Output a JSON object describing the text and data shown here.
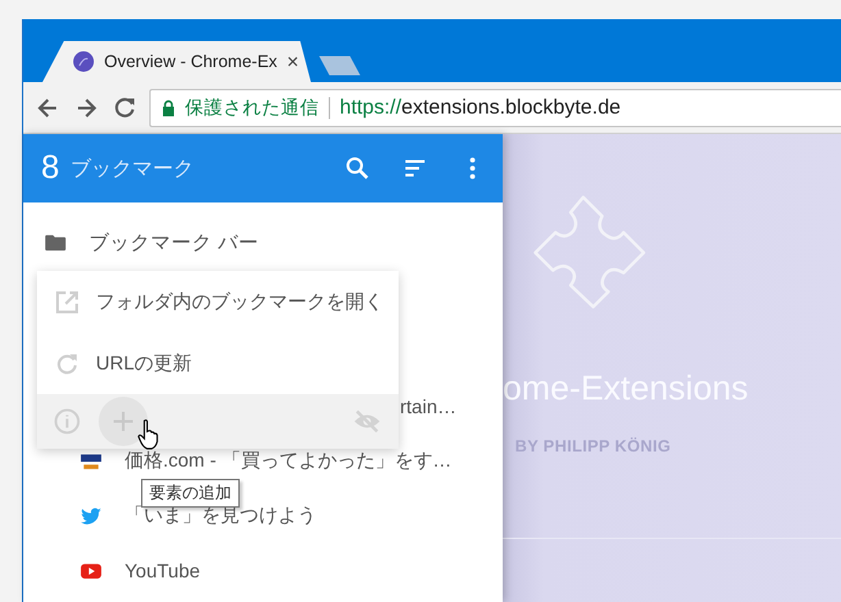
{
  "browser": {
    "tabs": [
      {
        "title": "Overview - Chrome-Ex",
        "selected": true,
        "close": "×"
      }
    ],
    "address_bar": {
      "security_label": "保護された通信",
      "url_scheme": "https://",
      "url_host": "extensions.blockbyte.de"
    }
  },
  "sidebar": {
    "count": "8",
    "title": "ブックマーク",
    "items": [
      {
        "kind": "folder",
        "label": "ブックマーク バー"
      },
      {
        "kind": "partial",
        "label": "rtain…"
      },
      {
        "kind": "site",
        "label": "価格.com - 「買ってよかった」をす…"
      },
      {
        "kind": "site",
        "label": "「いま」を見つけよう"
      },
      {
        "kind": "site",
        "label": "YouTube"
      }
    ]
  },
  "context_menu": {
    "items": [
      {
        "label": "フォルダ内のブックマークを開く"
      },
      {
        "label": "URLの更新"
      }
    ],
    "footer_buttons": [
      {
        "kind": "info",
        "hovered": false
      },
      {
        "kind": "add",
        "hovered": true
      },
      {
        "kind": "hide",
        "hovered": false
      }
    ]
  },
  "tooltip": "要素の追加",
  "page": {
    "title": "ome-Extensions",
    "byline": "BY PHILIPP KÖNIG"
  }
}
